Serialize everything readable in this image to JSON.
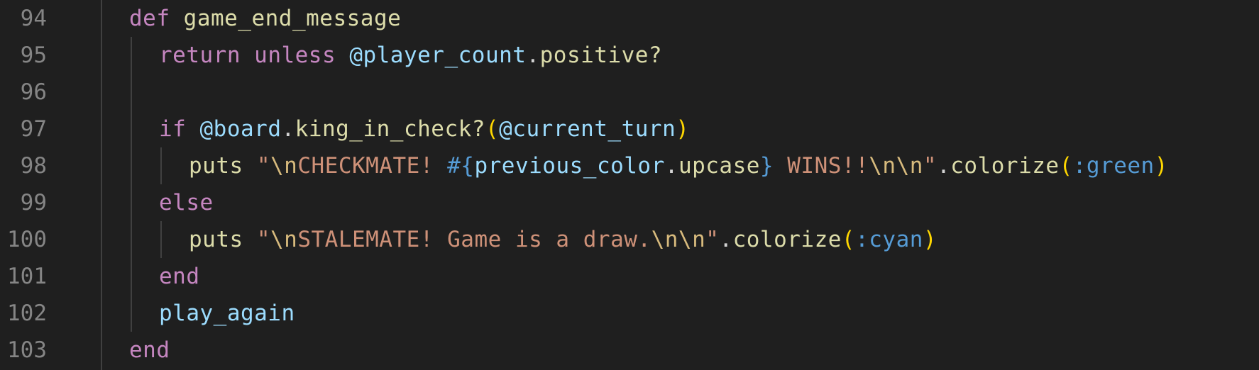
{
  "editor": {
    "background": "#1f1f1f",
    "lines": [
      {
        "number": "94",
        "tokens": [
          {
            "text": "def ",
            "cls": "kw"
          },
          {
            "text": "game_end_message",
            "cls": "fn"
          }
        ]
      },
      {
        "number": "95",
        "tokens": [
          {
            "text": "return ",
            "cls": "kw"
          },
          {
            "text": "unless ",
            "cls": "kw"
          },
          {
            "text": "@player_count",
            "cls": "var"
          },
          {
            "text": ".",
            "cls": "plain"
          },
          {
            "text": "positive?",
            "cls": "fn"
          }
        ]
      },
      {
        "number": "96",
        "tokens": []
      },
      {
        "number": "97",
        "tokens": [
          {
            "text": "if ",
            "cls": "kw"
          },
          {
            "text": "@board",
            "cls": "var"
          },
          {
            "text": ".",
            "cls": "plain"
          },
          {
            "text": "king_in_check?",
            "cls": "fn"
          },
          {
            "text": "(",
            "cls": "paren"
          },
          {
            "text": "@current_turn",
            "cls": "var"
          },
          {
            "text": ")",
            "cls": "paren"
          }
        ]
      },
      {
        "number": "98",
        "tokens": [
          {
            "text": "puts ",
            "cls": "fn"
          },
          {
            "text": "\"",
            "cls": "str"
          },
          {
            "text": "\\n",
            "cls": "esc"
          },
          {
            "text": "CHECKMATE! ",
            "cls": "str"
          },
          {
            "text": "#{",
            "cls": "interp"
          },
          {
            "text": "previous_color",
            "cls": "var"
          },
          {
            "text": ".",
            "cls": "plain"
          },
          {
            "text": "upcase",
            "cls": "fn"
          },
          {
            "text": "}",
            "cls": "interp"
          },
          {
            "text": " WINS!!",
            "cls": "str"
          },
          {
            "text": "\\n\\n",
            "cls": "esc"
          },
          {
            "text": "\"",
            "cls": "str"
          },
          {
            "text": ".",
            "cls": "plain"
          },
          {
            "text": "colorize",
            "cls": "fn"
          },
          {
            "text": "(",
            "cls": "paren"
          },
          {
            "text": ":green",
            "cls": "sym"
          },
          {
            "text": ")",
            "cls": "paren"
          }
        ]
      },
      {
        "number": "99",
        "tokens": [
          {
            "text": "else",
            "cls": "kw"
          }
        ]
      },
      {
        "number": "100",
        "tokens": [
          {
            "text": "puts ",
            "cls": "fn"
          },
          {
            "text": "\"",
            "cls": "str"
          },
          {
            "text": "\\n",
            "cls": "esc"
          },
          {
            "text": "STALEMATE! Game is a draw.",
            "cls": "str"
          },
          {
            "text": "\\n\\n",
            "cls": "esc"
          },
          {
            "text": "\"",
            "cls": "str"
          },
          {
            "text": ".",
            "cls": "plain"
          },
          {
            "text": "colorize",
            "cls": "fn"
          },
          {
            "text": "(",
            "cls": "paren"
          },
          {
            "text": ":cyan",
            "cls": "sym"
          },
          {
            "text": ")",
            "cls": "paren"
          }
        ]
      },
      {
        "number": "101",
        "tokens": [
          {
            "text": "end",
            "cls": "kw"
          }
        ]
      },
      {
        "number": "102",
        "tokens": [
          {
            "text": "play_again",
            "cls": "var"
          }
        ]
      },
      {
        "number": "103",
        "tokens": [
          {
            "text": "end",
            "cls": "kw"
          }
        ]
      }
    ]
  }
}
